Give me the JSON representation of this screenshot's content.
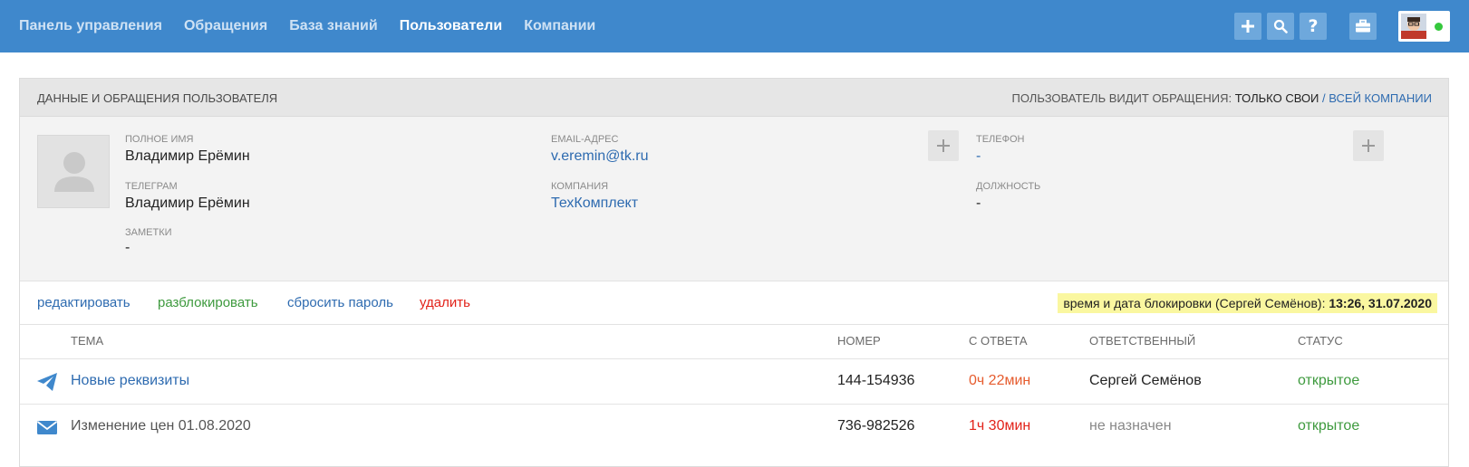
{
  "nav": {
    "items": [
      {
        "label": "Панель управления",
        "active": false
      },
      {
        "label": "Обращения",
        "active": false
      },
      {
        "label": "База знаний",
        "active": false
      },
      {
        "label": "Пользователи",
        "active": true
      },
      {
        "label": "Компании",
        "active": false
      }
    ]
  },
  "toolbar": {
    "icons": [
      "plus-icon",
      "search-icon",
      "help-icon",
      "briefcase-icon"
    ],
    "help_glyph": "?",
    "online": true
  },
  "card": {
    "title": "ДАННЫЕ И ОБРАЩЕНИЯ ПОЛЬЗОВАТЕЛЯ",
    "visibility_prefix": "ПОЛЬЗОВАТЕЛЬ ВИДИТ ОБРАЩЕНИЯ:",
    "visibility_own": "ТОЛЬКО СВОИ",
    "visibility_sep": "/",
    "visibility_all": "ВСЕЙ КОМПАНИИ"
  },
  "user": {
    "full_name_label": "ПОЛНОЕ ИМЯ",
    "full_name": "Владимир Ерёмин",
    "telegram_label": "ТЕЛЕГРАМ",
    "telegram": "Владимир Ерёмин",
    "notes_label": "ЗАМЕТКИ",
    "notes": "-",
    "email_label": "EMAIL-АДРЕС",
    "email": "v.eremin@tk.ru",
    "company_label": "КОМПАНИЯ",
    "company": "ТехКомплект",
    "phone_label": "ТЕЛЕФОН",
    "phone": "-",
    "position_label": "ДОЛЖНОСТЬ",
    "position": "-"
  },
  "actions": {
    "edit": "редактировать",
    "unblock": "разблокировать",
    "reset_password": "сбросить пароль",
    "delete": "удалить",
    "lock_note_prefix": "время и дата блокировки (Сергей Семёнов):",
    "lock_note_time": "13:26, 31.07.2020"
  },
  "colors": {
    "accent": "#3f88cc",
    "link": "#2e6bb0",
    "green": "#3e9a3e",
    "red": "#e2231a",
    "orange": "#e65c2e"
  },
  "table": {
    "headers": {
      "topic": "ТЕМА",
      "number": "НОМЕР",
      "since_reply": "С ОТВЕТА",
      "assignee": "ОТВЕТСТВЕННЫЙ",
      "status": "СТАТУС"
    },
    "rows": [
      {
        "icon": "telegram-icon",
        "topic": "Новые реквизиты",
        "number": "144-154936",
        "since_reply": "0ч 22мин",
        "assignee": "Сергей Семёнов",
        "status": "открытое"
      },
      {
        "icon": "mail-icon",
        "topic": "Изменение цен 01.08.2020",
        "number": "736-982526",
        "since_reply": "1ч 30мин",
        "assignee": "не назначен",
        "status": "открытое"
      }
    ]
  }
}
